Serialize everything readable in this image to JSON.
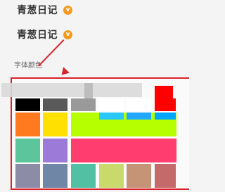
{
  "rows": [
    {
      "label": "青葱日记",
      "icon": "v-badge-icon",
      "badge_glyph": "v"
    },
    {
      "label": "青葱日记",
      "icon": "v-badge-icon",
      "badge_glyph": "v"
    }
  ],
  "section": {
    "label": "字体颜色"
  },
  "palette": {
    "accent_color": "#d9222b",
    "colors": [
      "#000000",
      "#5a5a5a",
      "#9a9a9a",
      "#ffffff",
      "#ffffff",
      "#ff0000",
      "#ff7a1f",
      "#ffe000",
      "#b6ff00",
      "#28c8ff",
      "#22a7ff",
      "#00a6ff",
      "#5cc59b",
      "#9b7ad8",
      "#ff3d6e",
      "#ff6b6b",
      "#f06ba5",
      "#e06b8f",
      "#8c8ca6",
      "#6f86a6",
      "#52c0a2",
      "#c9d96b",
      "#c59477",
      "#c46a6a"
    ]
  }
}
